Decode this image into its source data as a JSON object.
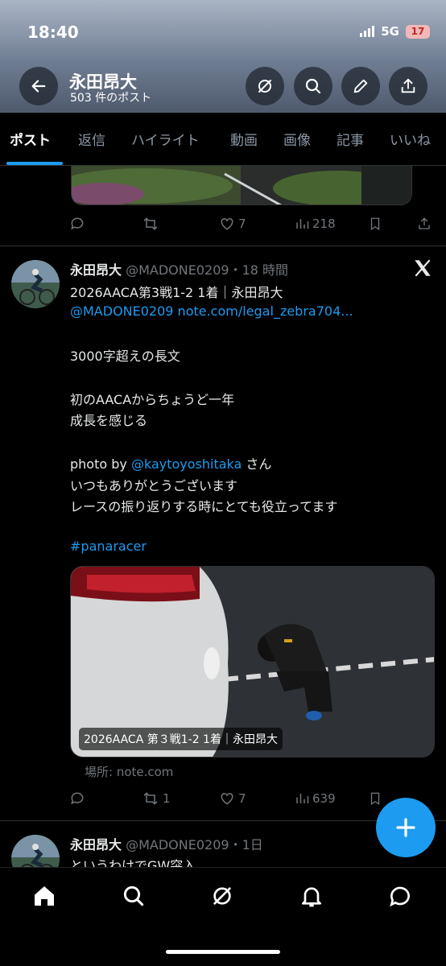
{
  "status_bar": {
    "time": "18:40",
    "network": "5G",
    "battery": "17"
  },
  "header": {
    "name": "永田昂大",
    "post_count": "503 件のポスト"
  },
  "tabs": [
    "ポスト",
    "返信",
    "ハイライト",
    "動画",
    "画像",
    "記事",
    "いいね"
  ],
  "prev_post": {
    "likes": "7",
    "views": "218"
  },
  "post": {
    "author": "永田昂大",
    "handle_time": "@MADONE0209・18 時間",
    "line1": "2026AACA第3戦1-2  1着｜永田昂大",
    "line2": "@MADONE0209 note.com/legal_zebra704...",
    "line3": "3000字超えの長文",
    "line4": "初のAACAからちょうど一年",
    "line5": "成長を感じる",
    "line6_prefix": "photo by ",
    "line6_mention": "@kaytoyoshitaka",
    "line6_suffix": " さん",
    "line7": "いつもありがとうございます",
    "line8": "レースの振り返りする時にとても役立ってます",
    "hashtag": "#panaracer",
    "media_caption": "2026AACA 第３戦1-2 1着｜永田昂大",
    "location": "場所: note.com",
    "retweets": "1",
    "likes": "7",
    "views": "639"
  },
  "next_post": {
    "author": "永田昂大",
    "handle_time": "@MADONE0209・1日",
    "text": "というわけでGW突入"
  },
  "colors": {
    "accent": "#1d9bf0",
    "background": "#000000",
    "muted": "#71767b"
  }
}
